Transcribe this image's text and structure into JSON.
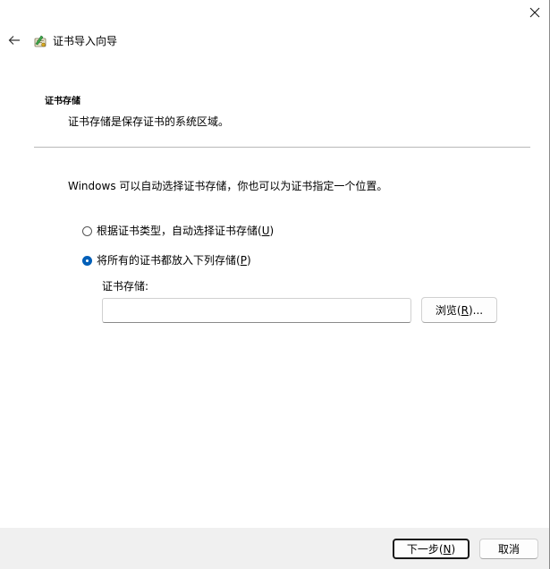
{
  "window": {
    "close_glyph": "✕",
    "back_glyph": "←",
    "title": "证书导入向导",
    "icon": "certificate-wizard-icon"
  },
  "page": {
    "section_title": "证书存储",
    "section_description": "证书存储是保存证书的系统区域。",
    "intro": "Windows 可以自动选择证书存储，你也可以为证书指定一个位置。"
  },
  "options": [
    {
      "label_prefix": "根据证书类型，自动选择证书存储(",
      "mnemonic": "U",
      "label_suffix": ")",
      "checked": false
    },
    {
      "label_prefix": "将所有的证书都放入下列存储(",
      "mnemonic": "P",
      "label_suffix": ")",
      "checked": true
    }
  ],
  "store": {
    "label": "证书存储:",
    "value": "",
    "browse_prefix": "浏览(",
    "browse_mnemonic": "R",
    "browse_suffix": ")..."
  },
  "footer": {
    "next_prefix": "下一步(",
    "next_mnemonic": "N",
    "next_suffix": ")",
    "cancel_label": "取消"
  },
  "colors": {
    "accent": "#005fb8",
    "footer_background": "#f0f0f0",
    "divider": "#b9b9b9"
  }
}
